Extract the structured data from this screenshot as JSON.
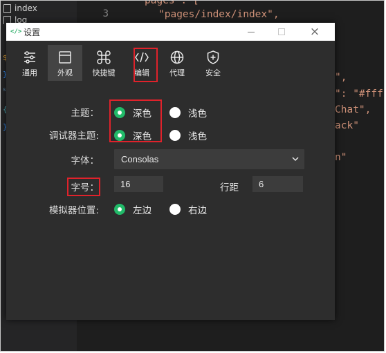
{
  "editor": {
    "explorer": {
      "items": [
        {
          "label": "index"
        },
        {
          "label": "log"
        }
      ],
      "markers": [
        "$",
        "}",
        "s",
        "{",
        "}"
      ]
    },
    "line_number": "3",
    "code_lines": [
      "pages\": [",
      "\"pages/index/index\",",
      "\",",
      "\": \"#fff",
      "Chat\",",
      "ack\"",
      "n\""
    ]
  },
  "window": {
    "title": "设置",
    "logo_text": "</>",
    "controls": {
      "minimize": "minimize-icon",
      "maximize": "maximize-icon",
      "close": "×"
    }
  },
  "tabs": [
    {
      "label": "通用",
      "icon": "sliders-icon"
    },
    {
      "label": "外观",
      "icon": "window-icon",
      "active": true
    },
    {
      "label": "快捷键",
      "icon": "command-icon"
    },
    {
      "label": "编辑",
      "icon": "code-icon"
    },
    {
      "label": "代理",
      "icon": "globe-icon"
    },
    {
      "label": "安全",
      "icon": "shield-icon"
    }
  ],
  "form": {
    "theme": {
      "label": "主题：",
      "options": [
        {
          "label": "深色",
          "checked": true
        },
        {
          "label": "浅色",
          "checked": false
        }
      ]
    },
    "debugger_theme": {
      "label": "调试器主题:",
      "options": [
        {
          "label": "深色",
          "checked": true
        },
        {
          "label": "浅色",
          "checked": false
        }
      ]
    },
    "font": {
      "label": "字体：",
      "value": "Consolas"
    },
    "font_size": {
      "label": "字号：",
      "value": "16"
    },
    "line_height": {
      "label": "行距",
      "value": "6"
    },
    "simulator_position": {
      "label": "模拟器位置:",
      "options": [
        {
          "label": "左边",
          "checked": true
        },
        {
          "label": "右边",
          "checked": false
        }
      ]
    }
  },
  "colors": {
    "accent": "#22ba69",
    "highlight": "#e0222b",
    "window_bg": "#2d2d2d",
    "editor_bg": "#1e1e1e"
  }
}
